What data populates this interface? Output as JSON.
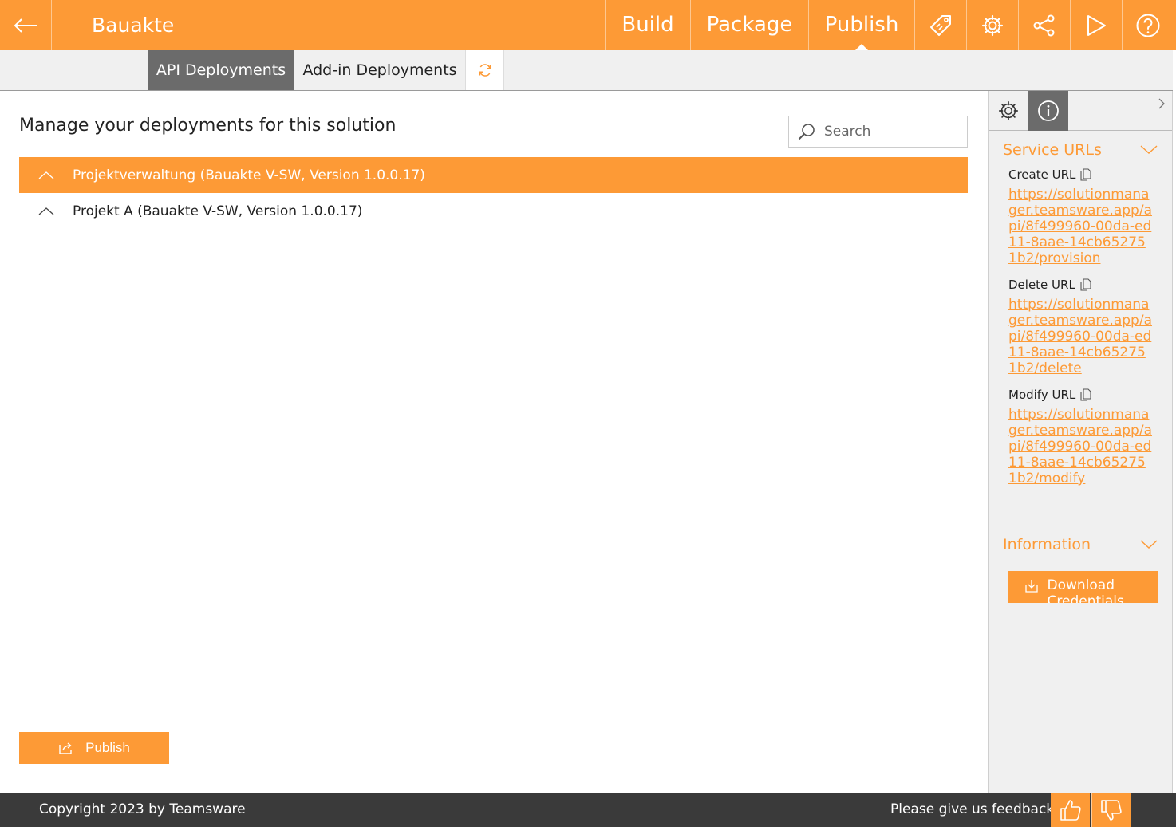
{
  "app": {
    "title": "Bauakte"
  },
  "nav": {
    "tabs": [
      {
        "label": "Build"
      },
      {
        "label": "Package"
      },
      {
        "label": "Publish",
        "active": true
      }
    ],
    "icons": [
      "tag-icon",
      "gear-icon",
      "share-icon",
      "play-icon",
      "help-icon"
    ]
  },
  "subtabs": [
    {
      "label": "API Deployments",
      "active": true
    },
    {
      "label": "Add-in Deployments"
    }
  ],
  "main": {
    "heading": "Manage your deployments for this solution",
    "search": {
      "placeholder": "Search",
      "value": ""
    },
    "deployments": [
      {
        "label": "Projektverwaltung (Bauakte V-SW, Version 1.0.0.17)",
        "selected": true
      },
      {
        "label": "Projekt A (Bauakte V-SW, Version 1.0.0.17)",
        "selected": false
      }
    ],
    "publish_label": "Publish"
  },
  "panel": {
    "service_urls_title": "Service URLs",
    "urls": [
      {
        "label": "Create URL",
        "url": "https://solutionmanager.teamsware.app/api/8f499960-00da-ed11-8aae-14cb652751b2/provision"
      },
      {
        "label": "Delete URL",
        "url": "https://solutionmanager.teamsware.app/api/8f499960-00da-ed11-8aae-14cb652751b2/delete"
      },
      {
        "label": "Modify URL",
        "url": "https://solutionmanager.teamsware.app/api/8f499960-00da-ed11-8aae-14cb652751b2/modify"
      }
    ],
    "information_title": "Information",
    "download_label": "Download Credentials"
  },
  "footer": {
    "copyright": "Copyright 2023 by Teamsware",
    "feedback": "Please give us feedback"
  },
  "colors": {
    "accent": "#fd9a36",
    "dark": "#3a3a3a",
    "tab_active": "#6b6b6b",
    "panel_bg": "#f0f0f0"
  }
}
